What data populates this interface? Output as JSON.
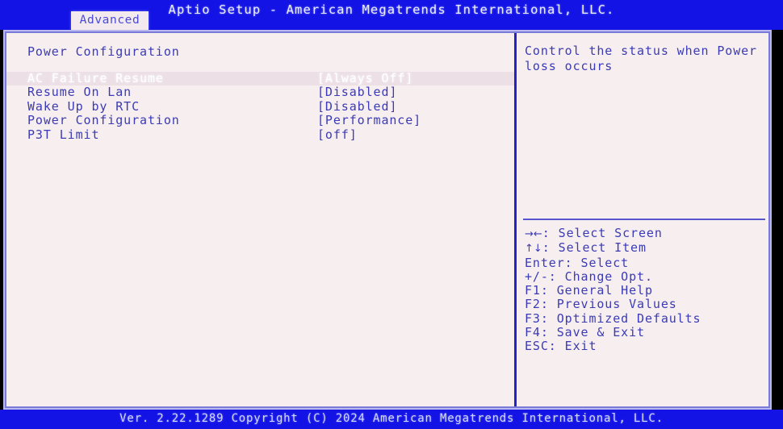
{
  "header": {
    "title": "Aptio Setup - American Megatrends International, LLC.",
    "active_tab": "Advanced"
  },
  "colors": {
    "band_blue": "#1313e6",
    "panel_background": "#f7eef0",
    "text_blue": "#3b3bb5",
    "selected_text": "#ffffff",
    "divider_blue": "#2323c8"
  },
  "settings_pane": {
    "section_title": "Power Configuration",
    "items": [
      {
        "label": "AC Failure Resume",
        "value": "[Always Off]",
        "selected": true
      },
      {
        "label": "Resume On Lan",
        "value": "[Disabled]",
        "selected": false
      },
      {
        "label": "Wake Up by RTC",
        "value": "[Disabled]",
        "selected": false
      },
      {
        "label": "Power Configuration",
        "value": "[Performance]",
        "selected": false
      },
      {
        "label": "P3T Limit",
        "value": "[off]",
        "selected": false
      }
    ]
  },
  "help_pane": {
    "description": "Control the status when Power loss occurs",
    "keys": [
      {
        "glyph": "→←",
        "text": ": Select Screen"
      },
      {
        "glyph": "↑↓",
        "text": ": Select Item"
      },
      {
        "glyph": "",
        "text": "Enter: Select"
      },
      {
        "glyph": "",
        "text": "+/-: Change Opt."
      },
      {
        "glyph": "",
        "text": "F1: General Help"
      },
      {
        "glyph": "",
        "text": "F2: Previous Values"
      },
      {
        "glyph": "",
        "text": "F3: Optimized Defaults"
      },
      {
        "glyph": "",
        "text": "F4: Save & Exit"
      },
      {
        "glyph": "",
        "text": "ESC: Exit"
      }
    ]
  },
  "footer": {
    "text": "Ver. 2.22.1289 Copyright (C) 2024 American Megatrends International, LLC."
  }
}
